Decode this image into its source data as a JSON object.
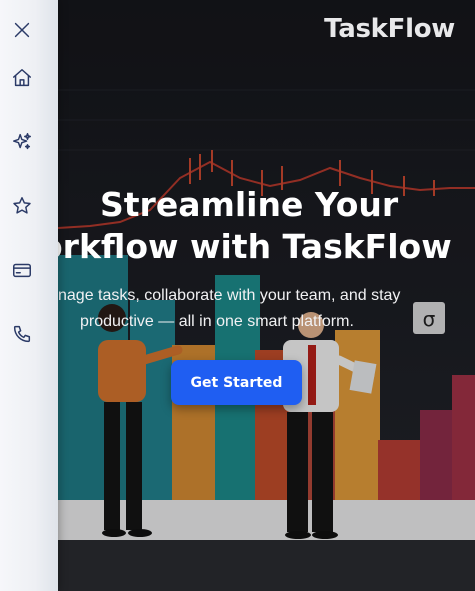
{
  "brand": {
    "name": "TaskFlow"
  },
  "hero": {
    "headline_line1": "Streamline Your",
    "headline_line2": "orkflow with TaskFlow",
    "subtext_line1": "nage tasks, collaborate with your team, and stay",
    "subtext_line2": "productive — all in one smart platform.",
    "cta_label": "Get Started"
  },
  "sidebar": {
    "items": [
      {
        "icon": "close-icon"
      },
      {
        "icon": "home-icon"
      },
      {
        "icon": "sparkles-icon"
      },
      {
        "icon": "star-icon"
      },
      {
        "icon": "credit-card-icon"
      },
      {
        "icon": "phone-icon"
      }
    ]
  },
  "colors": {
    "cta": "#1f5ef2",
    "sidebar_icon": "#2b3a67",
    "headline": "#ffffff"
  }
}
